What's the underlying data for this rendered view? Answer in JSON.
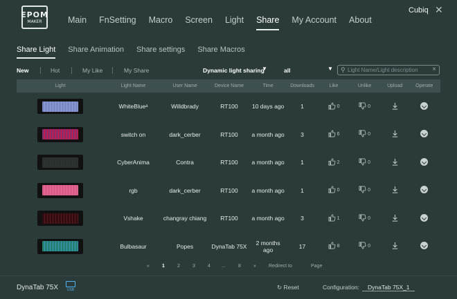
{
  "brand": {
    "logo_line1": "EPOM",
    "logo_line2": "MAKER"
  },
  "nav": {
    "items": [
      "Main",
      "FnSetting",
      "Macro",
      "Screen",
      "Light",
      "Share",
      "My Account",
      "About"
    ],
    "active": "Share"
  },
  "user": {
    "name": "Cubiq"
  },
  "subtabs": {
    "items": [
      "Share Light",
      "Share Animation",
      "Share settings",
      "Share Macros"
    ],
    "active": "Share Light"
  },
  "filters": {
    "tabs": [
      "New",
      "Hot",
      "My Like",
      "My Share"
    ],
    "category": "Dynamic light sharing",
    "scope": "all",
    "search_placeholder": "Light Name/Light description"
  },
  "table": {
    "headers": [
      "Light",
      "Light Name",
      "User Name",
      "Device Name",
      "Time",
      "Downloads",
      "Like",
      "Unlike",
      "Upload",
      "Operate"
    ],
    "rows": [
      {
        "light_name": "WhiteBlueᵃ",
        "user": "Willdbrady",
        "device": "RT100",
        "time": "10 days ago",
        "downloads": "1",
        "likes": "0",
        "unlikes": "0",
        "thumb_colors": [
          "#d9d9e6",
          "#8fa0d8",
          "#ffffff"
        ]
      },
      {
        "light_name": "switch on",
        "user": "dark_cerber",
        "device": "RT100",
        "time": "a month ago",
        "downloads": "3",
        "likes": "6",
        "unlikes": "0",
        "thumb_colors": [
          "#8a7ee0",
          "#ff5a7a",
          "#e0346e"
        ]
      },
      {
        "light_name": "CyberAnima",
        "user": "Contra",
        "device": "RT100",
        "time": "a month ago",
        "downloads": "1",
        "likes": "2",
        "unlikes": "0",
        "thumb_colors": [
          "#2fd6a0",
          "#d83a4a",
          "#3ae0b0"
        ]
      },
      {
        "light_name": "rgb",
        "user": "dark_cerber",
        "device": "RT100",
        "time": "a month ago",
        "downloads": "1",
        "likes": "0",
        "unlikes": "0",
        "thumb_colors": [
          "#f0a8c8",
          "#e888b0",
          "#ffd0e0"
        ]
      },
      {
        "light_name": "Vshake",
        "user": "changray chiang",
        "device": "RT100",
        "time": "a month ago",
        "downloads": "3",
        "likes": "1",
        "unlikes": "0",
        "thumb_colors": [
          "#3a3a3a",
          "#d83a4a",
          "#6a6a6a"
        ]
      },
      {
        "light_name": "Bulbasaur",
        "user": "Popes",
        "device": "DynaTab 75X",
        "time": "2 months ago",
        "downloads": "17",
        "likes": "8",
        "unlikes": "0",
        "thumb_colors": [
          "#7bd08a",
          "#4aa0d8",
          "#e0e8e0"
        ]
      }
    ]
  },
  "pager": {
    "prev": "«",
    "pages": [
      "1",
      "2",
      "3",
      "4",
      "...",
      "8"
    ],
    "next": "»",
    "current": "1",
    "redirect_label": "Redirect to",
    "page_label": "Page"
  },
  "footer": {
    "device": "DynaTab 75X",
    "usb_label": "USB",
    "reset_label": "Reset",
    "config_label": "Configuration:",
    "config_value": "DynaTab 75X_1"
  },
  "colors": {
    "background": "#2b3b3a",
    "header_row": "#3d4f4e",
    "usb_accent": "#4fb3f0"
  },
  "icons": {
    "like": "thumbs-up-icon",
    "unlike": "thumbs-down-icon",
    "upload": "download-icon",
    "operate": "chevron-circle-icon",
    "search": "search-icon",
    "clear": "close-icon",
    "reset": "refresh-icon",
    "window_close": "close-icon"
  }
}
